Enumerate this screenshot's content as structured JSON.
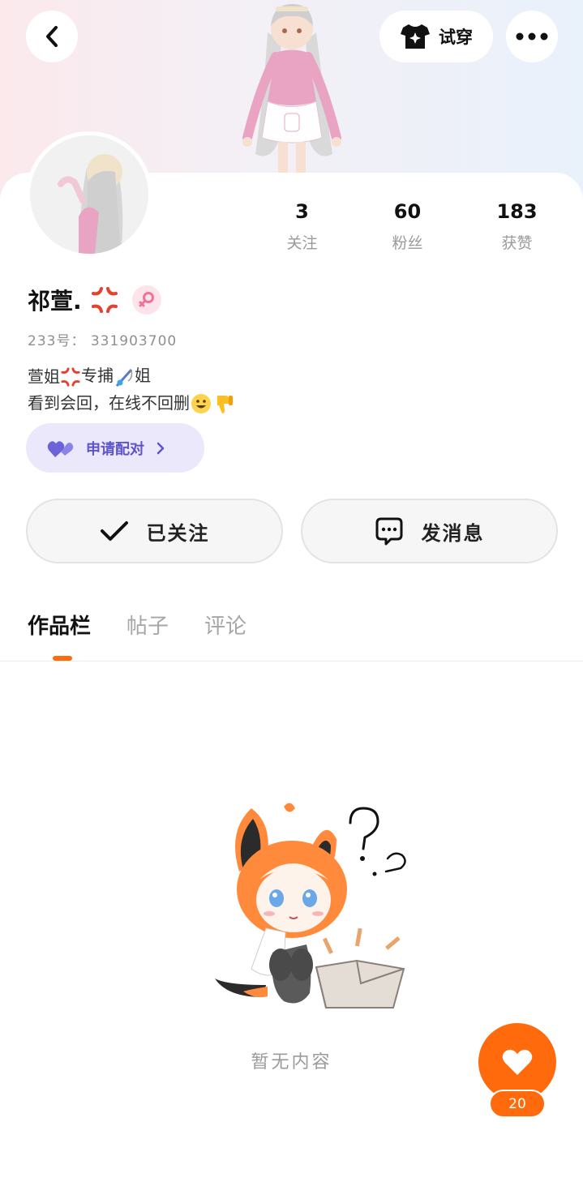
{
  "header": {
    "tryon_label": "试穿"
  },
  "stats": [
    {
      "value": "3",
      "label": "关注"
    },
    {
      "value": "60",
      "label": "粉丝"
    },
    {
      "value": "183",
      "label": "获赞"
    }
  ],
  "profile": {
    "name": "祁萱.",
    "uid": "233号： 331903700",
    "bio_line1_a": "萱姐",
    "bio_line1_b": "专捕",
    "bio_line1_c": "姐",
    "bio_line2": "看到会回，在线不回删",
    "pair_label": "申请配对"
  },
  "actions": {
    "follow_label": "已关注",
    "message_label": "发消息"
  },
  "tabs": [
    {
      "label": "作品栏",
      "active": true
    },
    {
      "label": "帖子",
      "active": false
    },
    {
      "label": "评论",
      "active": false
    }
  ],
  "empty": {
    "text": "暂无内容"
  },
  "fab": {
    "count": "20"
  },
  "colors": {
    "accent": "#ff6a0c",
    "pair_bg": "#ebe8fb",
    "pair_text": "#5d55c9"
  }
}
